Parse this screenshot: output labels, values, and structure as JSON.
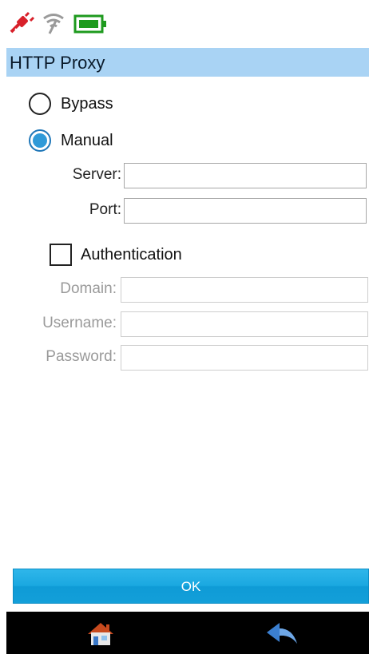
{
  "status_bar": {
    "icons": [
      "power-plug-disconnected-icon",
      "wifi-off-icon",
      "battery-icon"
    ],
    "colors": {
      "plug": "#d8202a",
      "wifi": "#9a9a9a",
      "battery": "#1e9a1e"
    }
  },
  "title": "HTTP Proxy",
  "proxy_mode": {
    "options": [
      {
        "label": "Bypass",
        "checked": false
      },
      {
        "label": "Manual",
        "checked": true
      }
    ]
  },
  "server": {
    "label": "Server:",
    "value": ""
  },
  "port": {
    "label": "Port:",
    "value": ""
  },
  "authentication": {
    "label": "Authentication",
    "checked": false,
    "domain": {
      "label": "Domain:",
      "value": ""
    },
    "username": {
      "label": "Username:",
      "value": ""
    },
    "password": {
      "label": "Password:",
      "value": ""
    }
  },
  "ok_button": {
    "label": "OK"
  },
  "nav": {
    "home_icon": "home-icon",
    "back_icon": "back-arrow-icon"
  },
  "colors": {
    "title_bar": "#a9d3f4",
    "accent": "#1aa8e0",
    "nav_bar": "#000000"
  }
}
